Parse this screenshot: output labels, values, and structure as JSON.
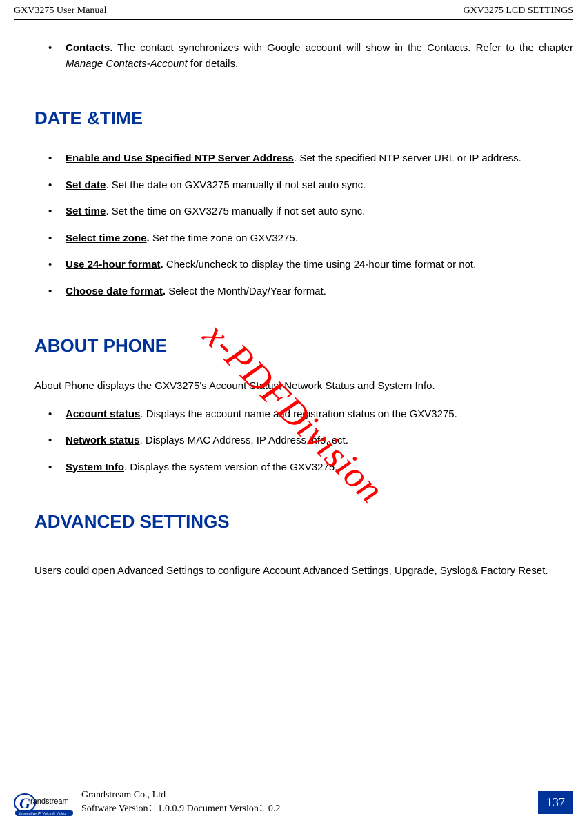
{
  "header": {
    "left": "GXV3275 User Manual",
    "right": "GXV3275 LCD SETTINGS"
  },
  "intro_bullet": {
    "label": "Contacts",
    "text1": ". The contact synchronizes with Google account will show in the Contacts. Refer to the chapter ",
    "ref": "Manage Contacts-Account",
    "text2": " for details."
  },
  "section_date": {
    "title": "DATE &TIME",
    "items": [
      {
        "label": "Enable and Use Specified NTP Server Address",
        "sep": ". ",
        "text": "Set the specified NTP server URL or IP address.",
        "punct_bold": false
      },
      {
        "label": "Set date",
        "sep": ". ",
        "text": "Set the date on GXV3275 manually if not set auto sync.",
        "punct_bold": false
      },
      {
        "label": "Set time",
        "sep": ". ",
        "text": "Set the time on GXV3275 manually if not set auto sync.",
        "punct_bold": false
      },
      {
        "label": "Select time zone.",
        "sep": " ",
        "text": "Set the time zone on GXV3275.",
        "punct_bold": true
      },
      {
        "label": "Use 24-hour format.",
        "sep": " ",
        "text": "Check/uncheck to display the time using 24-hour time format or not.",
        "punct_bold": true
      },
      {
        "label": "Choose date format.",
        "sep": " ",
        "text": "Select the Month/Day/Year format.",
        "punct_bold": true
      }
    ]
  },
  "section_about": {
    "title": "ABOUT PHONE",
    "intro": "About Phone displays the GXV3275's Account Status, Network Status and System Info.",
    "items": [
      {
        "label": "Account status",
        "text": ". Displays the account name and registration status on the GXV3275."
      },
      {
        "label": "Network status",
        "text": ". Displays MAC Address, IP Address info, ect."
      },
      {
        "label": "System Info",
        "text": ". Displays the system version of the GXV3275."
      }
    ]
  },
  "section_adv": {
    "title": "ADVANCED SETTINGS",
    "text": "Users could open Advanced Settings to configure Account Advanced Settings, Upgrade, Syslog& Factory Reset."
  },
  "watermark": "x-PDFDivision",
  "footer": {
    "company": "Grandstream Co., Ltd",
    "version": "Software Version：1.0.0.9 Document Version：0.2",
    "page": "137",
    "logo_main": "randstream",
    "logo_tag": "Innovative IP Voice & Video"
  }
}
